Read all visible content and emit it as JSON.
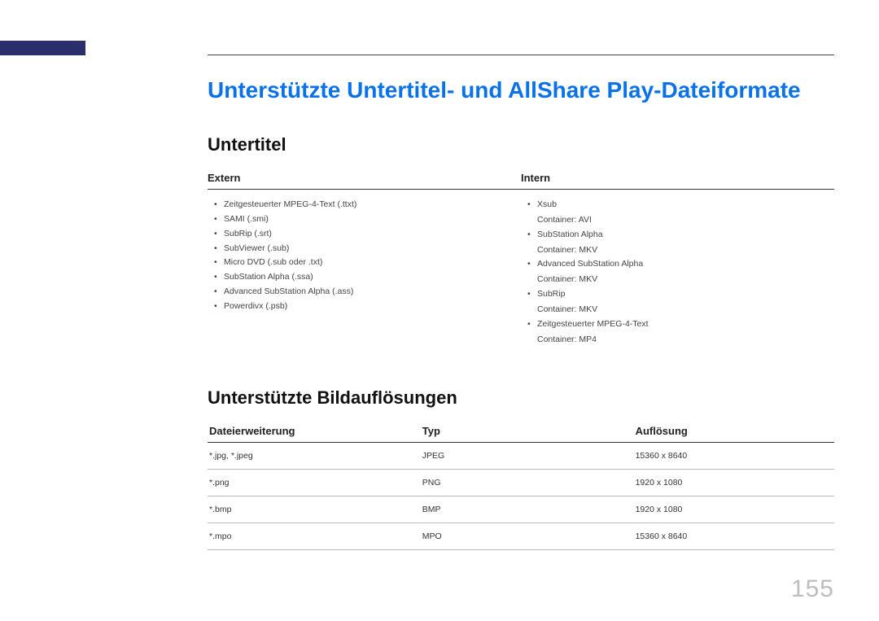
{
  "page_number": "155",
  "title": "Unterstützte Untertitel- und AllShare Play-Dateiformate",
  "subtitles": {
    "heading": "Untertitel",
    "extern": {
      "header": "Extern",
      "items": [
        {
          "text": "Zeitgesteuerter MPEG-4-Text (.ttxt)"
        },
        {
          "text": "SAMI (.smi)"
        },
        {
          "text": "SubRip (.srt)"
        },
        {
          "text": "SubViewer (.sub)"
        },
        {
          "text": "Micro DVD (.sub oder .txt)"
        },
        {
          "text": "SubStation Alpha (.ssa)"
        },
        {
          "text": "Advanced SubStation Alpha (.ass)"
        },
        {
          "text": "Powerdivx (.psb)"
        }
      ]
    },
    "intern": {
      "header": "Intern",
      "items": [
        {
          "text": "Xsub",
          "container": "Container: AVI"
        },
        {
          "text": "SubStation Alpha",
          "container": "Container: MKV"
        },
        {
          "text": "Advanced SubStation Alpha",
          "container": "Container: MKV"
        },
        {
          "text": "SubRip",
          "container": "Container: MKV"
        },
        {
          "text": "Zeitgesteuerter MPEG-4-Text",
          "container": "Container: MP4"
        }
      ]
    }
  },
  "resolutions": {
    "heading": "Unterstützte Bildauflösungen",
    "headers": {
      "ext": "Dateierweiterung",
      "typ": "Typ",
      "res": "Auflösung"
    },
    "rows": [
      {
        "ext": "*.jpg, *.jpeg",
        "typ": "JPEG",
        "res": "15360 x 8640"
      },
      {
        "ext": "*.png",
        "typ": "PNG",
        "res": "1920 x 1080"
      },
      {
        "ext": "*.bmp",
        "typ": "BMP",
        "res": "1920 x 1080"
      },
      {
        "ext": "*.mpo",
        "typ": "MPO",
        "res": "15360 x 8640"
      }
    ]
  }
}
